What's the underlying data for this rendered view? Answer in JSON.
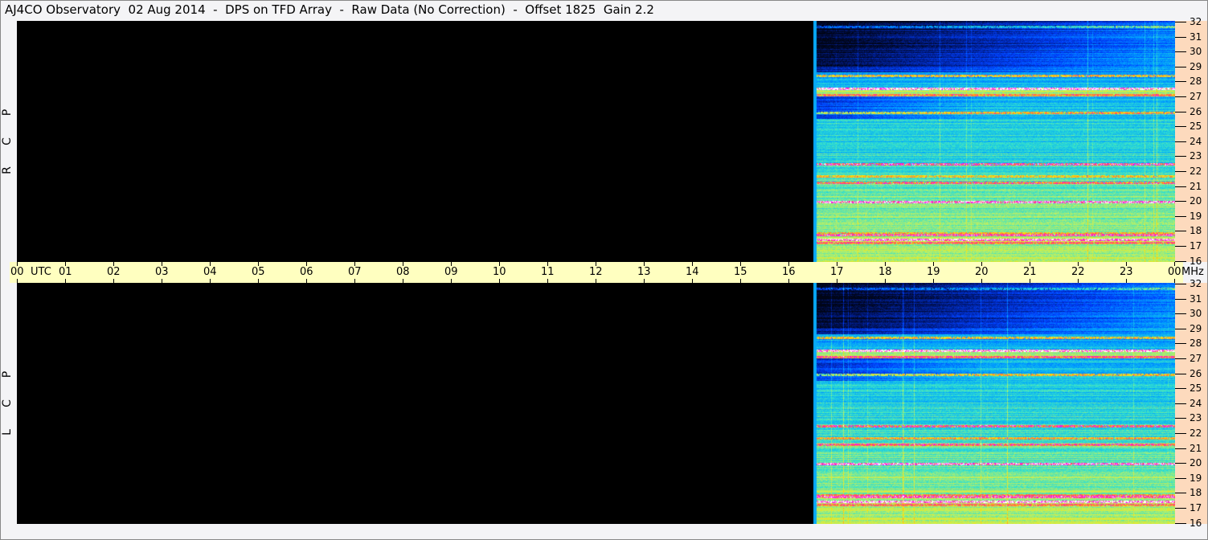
{
  "title": "AJ4CO Observatory  02 Aug 2014  -  DPS on TFD Array  -  Raw Data (No Correction)  -  Offset 1825  Gain 2.2",
  "chart_data": {
    "type": "heatmap",
    "title": "AJ4CO Observatory  02 Aug 2014  -  DPS on TFD Array  -  Raw Data (No Correction)  -  Offset 1825  Gain 2.2",
    "xlabel": "UTC",
    "ylabel": "MHz",
    "x_range_utc_hours": [
      0,
      24
    ],
    "y_range_mhz": [
      16,
      32
    ],
    "x_ticks": [
      "00",
      "01",
      "02",
      "03",
      "04",
      "05",
      "06",
      "07",
      "08",
      "09",
      "10",
      "11",
      "12",
      "13",
      "14",
      "15",
      "16",
      "17",
      "18",
      "19",
      "20",
      "21",
      "22",
      "23",
      "00"
    ],
    "y_ticks": [
      "32",
      "31",
      "30",
      "29",
      "28",
      "27",
      "26",
      "25",
      "24",
      "23",
      "22",
      "21",
      "20",
      "19",
      "18",
      "17",
      "16"
    ],
    "x_unit_label": "UTC",
    "y_unit_label": "MHz",
    "data_start_utc": 16.5,
    "interference_bands_mhz": [
      31.6,
      28.4,
      27.5,
      27.1,
      25.9,
      22.5,
      21.7,
      21.3,
      20.0,
      17.9,
      17.8,
      17.5,
      17.3
    ],
    "colormap": [
      "#000000",
      "#001a80",
      "#0040ff",
      "#00a0ff",
      "#30e0d0",
      "#c0f060",
      "#ffe000",
      "#ff6040",
      "#ff00ff",
      "#ffffff"
    ],
    "series": [
      {
        "name": "RCP",
        "label_letters": [
          "R",
          "C",
          "P"
        ]
      },
      {
        "name": "LCP",
        "label_letters": [
          "L",
          "C",
          "P"
        ]
      }
    ]
  }
}
